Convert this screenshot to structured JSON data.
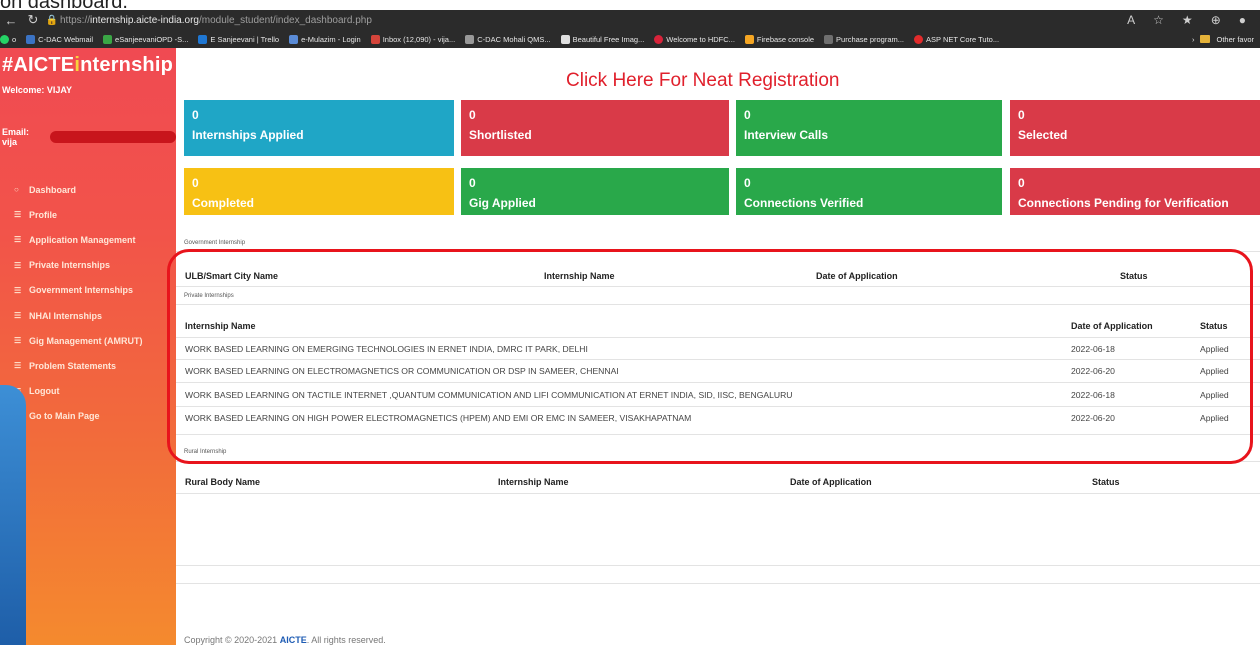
{
  "caption": "on dashboard.",
  "browser": {
    "url_prefix": "https://",
    "url_host": "internship.aicte-india.org",
    "url_path": "/module_student/index_dashboard.php",
    "bookmarks": [
      "C-DAC Webmail",
      "eSanjeevaniOPD -S...",
      "E Sanjeevani | Trello",
      "e-Mulazim - Login",
      "Inbox (12,090) - vija...",
      "C-DAC Mohali QMS...",
      "Beautiful Free Imag...",
      "Welcome to HDFC...",
      "Firebase console",
      "Purchase program...",
      "ASP NET Core Tuto..."
    ],
    "other_favorites": "Other favor"
  },
  "sidebar": {
    "brand_prefix": "#AICTE",
    "brand_mark": "i",
    "brand_suffix": "nternship",
    "welcome": "Welcome: VIJAY",
    "email_label": "Email: vija",
    "items": [
      {
        "label": "Dashboard",
        "icon": "circle-icon"
      },
      {
        "label": "Profile",
        "icon": "list-icon"
      },
      {
        "label": "Application Management",
        "icon": "list-icon"
      },
      {
        "label": "Private Internships",
        "icon": "list-icon"
      },
      {
        "label": "Government Internships",
        "icon": "list-icon"
      },
      {
        "label": "NHAI Internships",
        "icon": "list-icon"
      },
      {
        "label": "Gig Management (AMRUT)",
        "icon": "list-icon"
      },
      {
        "label": "Problem Statements",
        "icon": "list-icon"
      },
      {
        "label": "Logout",
        "icon": "list-icon"
      },
      {
        "label": "Go to Main Page",
        "icon": "list-icon"
      }
    ]
  },
  "main": {
    "registration_link": "Click Here For Neat Registration",
    "cards": [
      {
        "count": "0",
        "label": "Internships Applied",
        "color": "#1fa6c6"
      },
      {
        "count": "0",
        "label": "Shortlisted",
        "color": "#d93a48"
      },
      {
        "count": "0",
        "label": "Interview Calls",
        "color": "#29a84a"
      },
      {
        "count": "0",
        "label": "Selected",
        "color": "#d93a48"
      },
      {
        "count": "0",
        "label": "Completed",
        "color": "#f7c114"
      },
      {
        "count": "0",
        "label": "Gig Applied",
        "color": "#29a84a"
      },
      {
        "count": "0",
        "label": "Connections Verified",
        "color": "#29a84a"
      },
      {
        "count": "0",
        "label": "Connections Pending for Verification",
        "color": "#d93a48"
      }
    ],
    "government": {
      "caption": "Government Internship",
      "headers": [
        "ULB/Smart City Name",
        "Internship Name",
        "Date of Application",
        "Status"
      ]
    },
    "private": {
      "caption": "Private Internships",
      "headers": [
        "Internship Name",
        "Date of Application",
        "Status"
      ],
      "rows": [
        {
          "name": "WORK BASED LEARNING ON EMERGING TECHNOLOGIES IN ERNET INDIA, DMRC IT PARK, DELHI",
          "date": "2022-06-18",
          "status": "Applied"
        },
        {
          "name": "WORK BASED LEARNING ON ELECTROMAGNETICS OR COMMUNICATION OR DSP IN SAMEER, CHENNAI",
          "date": "2022-06-20",
          "status": "Applied"
        },
        {
          "name": "WORK BASED LEARNING ON TACTILE INTERNET ,QUANTUM COMMUNICATION AND LIFI COMMUNICATION AT ERNET INDIA, SID, IISC, BENGALURU",
          "date": "2022-06-18",
          "status": "Applied"
        },
        {
          "name": "WORK BASED LEARNING ON HIGH POWER ELECTROMAGNETICS (HPEM) AND EMI OR EMC IN SAMEER, VISAKHAPATNAM",
          "date": "2022-06-20",
          "status": "Applied"
        }
      ]
    },
    "rural": {
      "caption": "Rural Internship",
      "headers": [
        "Rural Body Name",
        "Internship Name",
        "Date of Application",
        "Status"
      ]
    },
    "footer_prefix": "Copyright © 2020-2021 ",
    "footer_brand": "AICTE",
    "footer_suffix": ". All rights reserved."
  }
}
